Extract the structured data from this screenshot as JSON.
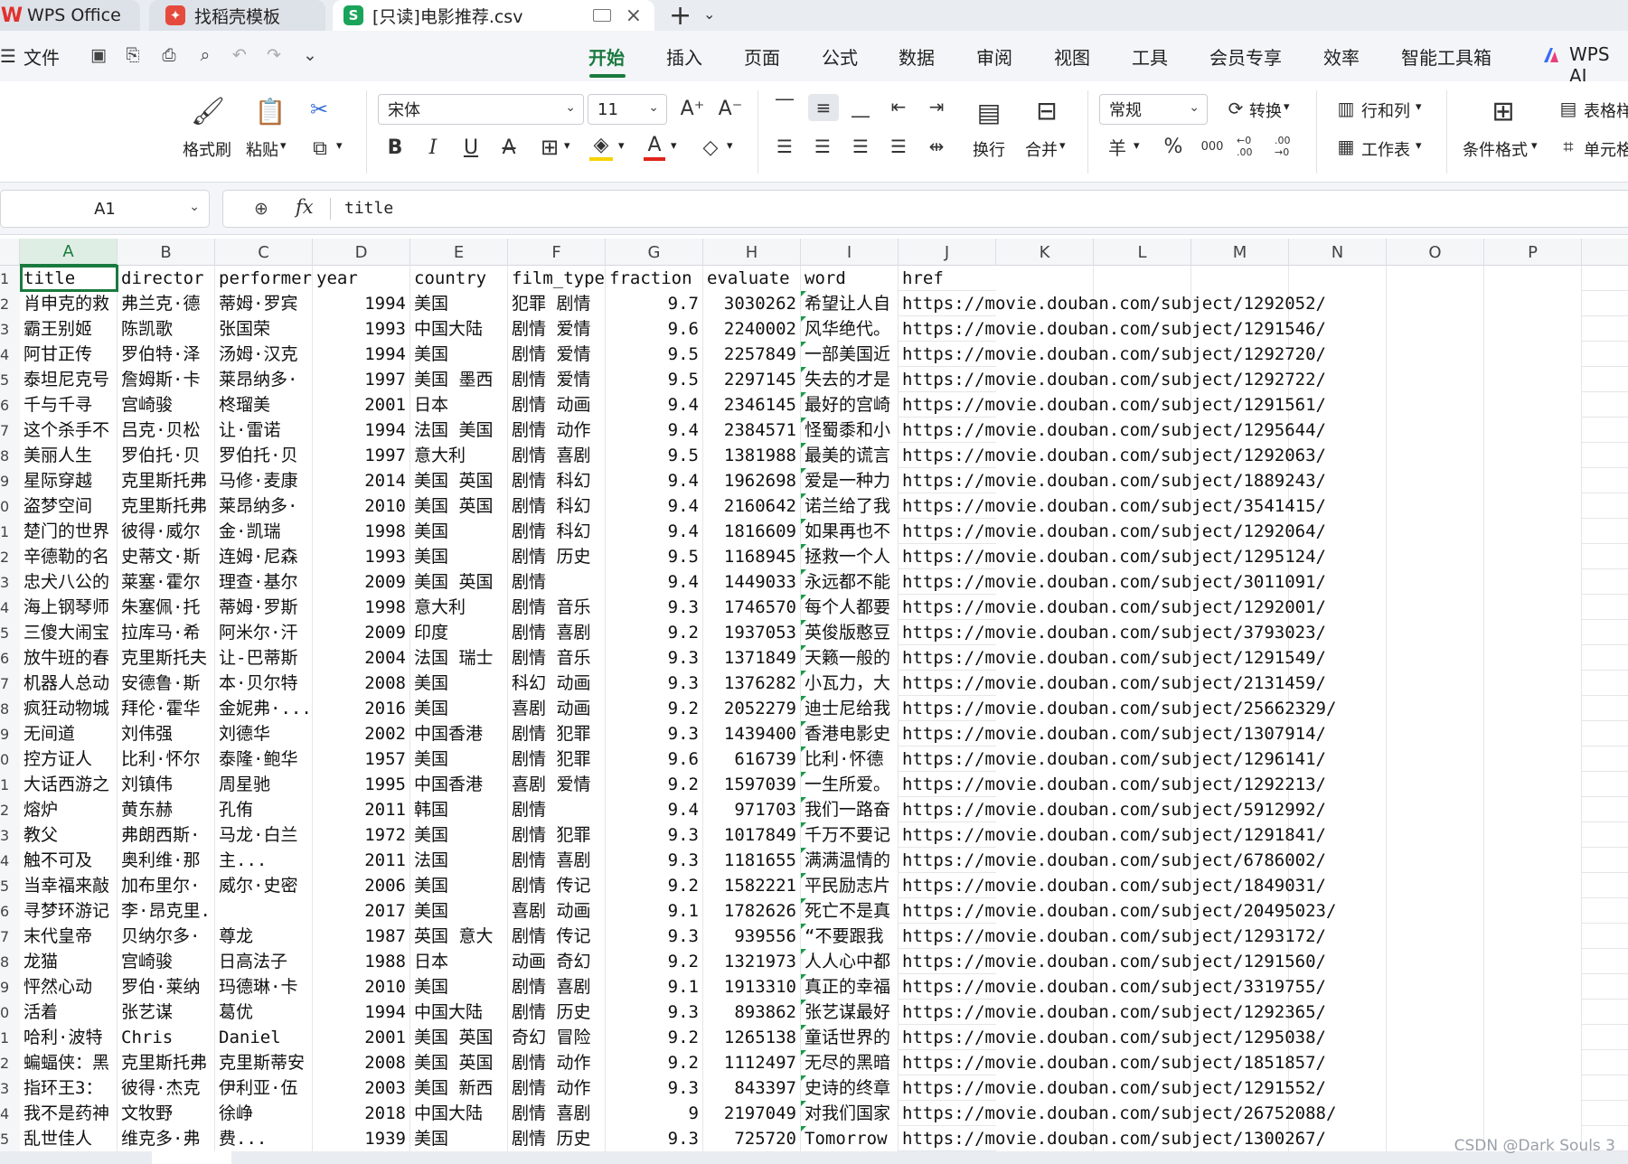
{
  "tabs": {
    "app": "WPS Office",
    "template": "找稻壳模板",
    "file": "[只读]电影推荐.csv",
    "file_icon_letter": "S"
  },
  "menu": {
    "file": "文件",
    "items": [
      "开始",
      "插入",
      "页面",
      "公式",
      "数据",
      "审阅",
      "视图",
      "工具",
      "会员专享",
      "效率",
      "智能工具箱",
      "WPS AI"
    ],
    "active_index": 0
  },
  "ribbon": {
    "format_painter": "格式刷",
    "paste": "粘贴",
    "font_name": "宋体",
    "font_size": "11",
    "wrap": "换行",
    "merge": "合并",
    "number_format": "常规",
    "convert": "转换",
    "rows_cols": "行和列",
    "worksheet": "工作表",
    "cond_format": "条件格式",
    "table_style": "表格样",
    "cell": "单元格",
    "bold": "B",
    "italic": "I",
    "underline": "U",
    "strike": "A",
    "currency": "羊",
    "percent": "%",
    "thousands": "000",
    "dec_inc": "←0 .00",
    "dec_dec": ".00 →0",
    "font_grow": "A⁺",
    "font_shrink": "A⁻"
  },
  "formula_bar": {
    "cell_ref": "A1",
    "fx": "fx",
    "value": "title"
  },
  "grid": {
    "columns": [
      "A",
      "B",
      "C",
      "D",
      "E",
      "F",
      "G",
      "H",
      "I",
      "J",
      "K",
      "L",
      "M",
      "N",
      "O",
      "P"
    ],
    "selected_column": "A",
    "row_numbers": [
      "1",
      "2",
      "3",
      "4",
      "5",
      "6",
      "7",
      "8",
      "9",
      "0",
      "1",
      "2",
      "3",
      "4",
      "5",
      "6",
      "7",
      "8",
      "9",
      "0",
      "1",
      "2",
      "3",
      "4",
      "5",
      "6",
      "7",
      "8",
      "9",
      "0",
      "1",
      "2",
      "3",
      "4",
      "5"
    ],
    "header": [
      "title",
      "director",
      "performer",
      "year",
      "country",
      "film_type",
      "fraction",
      "evaluate",
      "word",
      "href"
    ],
    "rows": [
      [
        "肖申克的救",
        "弗兰克·德",
        "蒂姆·罗宾",
        "1994",
        "美国",
        "犯罪 剧情",
        "9.7",
        "3030262",
        "希望让人自",
        "https://movie.douban.com/subject/1292052/"
      ],
      [
        "霸王别姬",
        "陈凯歌",
        "张国荣",
        "1993",
        "中国大陆 ",
        "剧情 爱情",
        "9.6",
        "2240002",
        "风华绝代。",
        "https://movie.douban.com/subject/1291546/"
      ],
      [
        "阿甘正传",
        "罗伯特·泽",
        "汤姆·汉克",
        "1994",
        "美国",
        "剧情 爱情",
        "9.5",
        "2257849",
        "一部美国近",
        "https://movie.douban.com/subject/1292720/"
      ],
      [
        "泰坦尼克号",
        "詹姆斯·卡",
        "莱昂纳多·",
        "1997",
        "美国 墨西",
        "剧情 爱情",
        "9.5",
        "2297145",
        "失去的才是",
        "https://movie.douban.com/subject/1292722/"
      ],
      [
        "千与千寻",
        "宫崎骏",
        "柊瑠美",
        "2001",
        "日本",
        "剧情 动画",
        "9.4",
        "2346145",
        "最好的宫崎",
        "https://movie.douban.com/subject/1291561/"
      ],
      [
        "这个杀手不",
        "吕克·贝松",
        "让·雷诺",
        "1994",
        "法国 美国",
        "剧情 动作",
        "9.4",
        "2384571",
        "怪蜀黍和小",
        "https://movie.douban.com/subject/1295644/"
      ],
      [
        "美丽人生",
        "罗伯托·贝",
        "罗伯托·贝",
        "1997",
        "意大利",
        "剧情 喜剧",
        "9.5",
        "1381988",
        "最美的谎言",
        "https://movie.douban.com/subject/1292063/"
      ],
      [
        "星际穿越",
        "克里斯托弗",
        "马修·麦康",
        "2014",
        "美国 英国",
        "剧情 科幻",
        "9.4",
        "1962698",
        "爱是一种力",
        "https://movie.douban.com/subject/1889243/"
      ],
      [
        "盗梦空间",
        "克里斯托弗",
        "莱昂纳多·",
        "2010",
        "美国 英国",
        "剧情 科幻",
        "9.4",
        "2160642",
        "诺兰给了我",
        "https://movie.douban.com/subject/3541415/"
      ],
      [
        "楚门的世界",
        "彼得·威尔",
        "金·凯瑞",
        "1998",
        "美国",
        "剧情 科幻",
        "9.4",
        "1816609",
        "如果再也不",
        "https://movie.douban.com/subject/1292064/"
      ],
      [
        "辛德勒的名",
        "史蒂文·斯",
        "连姆·尼森",
        "1993",
        "美国",
        "剧情 历史",
        "9.5",
        "1168945",
        "拯救一个人",
        "https://movie.douban.com/subject/1295124/"
      ],
      [
        "忠犬八公的",
        "莱塞·霍尔",
        "理查·基尔",
        "2009",
        "美国 英国",
        "剧情",
        "9.4",
        "1449033",
        "永远都不能",
        "https://movie.douban.com/subject/3011091/"
      ],
      [
        "海上钢琴师",
        "朱塞佩·托",
        "蒂姆·罗斯",
        "1998",
        "意大利",
        "剧情 音乐",
        "9.3",
        "1746570",
        "每个人都要",
        "https://movie.douban.com/subject/1292001/"
      ],
      [
        "三傻大闹宝",
        "拉库马·希",
        "阿米尔·汗",
        "2009",
        "印度",
        "剧情 喜剧",
        "9.2",
        "1937053",
        "英俊版憨豆",
        "https://movie.douban.com/subject/3793023/"
      ],
      [
        "放牛班的春",
        "克里斯托夫",
        "让-巴蒂斯",
        "2004",
        "法国 瑞士",
        "剧情 音乐",
        "9.3",
        "1371849",
        "天籁一般的",
        "https://movie.douban.com/subject/1291549/"
      ],
      [
        "机器人总动",
        "安德鲁·斯",
        "本·贝尔特",
        "2008",
        "美国",
        "科幻 动画",
        "9.3",
        "1376282",
        "小瓦力，大",
        "https://movie.douban.com/subject/2131459/"
      ],
      [
        "疯狂动物城",
        "拜伦·霍华",
        "金妮弗·...",
        "2016",
        "美国",
        "喜剧 动画",
        "9.2",
        "2052279",
        "迪士尼给我",
        "https://movie.douban.com/subject/25662329/"
      ],
      [
        "无间道",
        "刘伟强",
        "刘德华",
        "2002",
        "中国香港",
        "剧情 犯罪",
        "9.3",
        "1439400",
        "香港电影史",
        "https://movie.douban.com/subject/1307914/"
      ],
      [
        "控方证人",
        "比利·怀尔",
        "泰隆·鲍华",
        "1957",
        "美国",
        "剧情 犯罪",
        "9.6",
        "616739",
        "比利·怀德",
        "https://movie.douban.com/subject/1296141/"
      ],
      [
        "大话西游之",
        "刘镇伟",
        "周星驰",
        "1995",
        "中国香港 ",
        "喜剧 爱情",
        "9.2",
        "1597039",
        "一生所爱。",
        "https://movie.douban.com/subject/1292213/"
      ],
      [
        "熔炉",
        "黄东赫",
        "孔侑",
        "2011",
        "韩国",
        "剧情",
        "9.4",
        "971703",
        "我们一路奋",
        "https://movie.douban.com/subject/5912992/"
      ],
      [
        "教父",
        "弗朗西斯·",
        "马龙·白兰",
        "1972",
        "美国",
        "剧情 犯罪",
        "9.3",
        "1017849",
        "千万不要记",
        "https://movie.douban.com/subject/1291841/"
      ],
      [
        "触不可及",
        "奥利维·那",
        "主...",
        "2011",
        "法国",
        "剧情 喜剧",
        "9.3",
        "1181655",
        "满满温情的",
        "https://movie.douban.com/subject/6786002/"
      ],
      [
        "当幸福来敲",
        "加布里尔·",
        "威尔·史密",
        "2006",
        "美国",
        "剧情 传记",
        "9.2",
        "1582221",
        "平民励志片",
        "https://movie.douban.com/subject/1849031/"
      ],
      [
        "寻梦环游记",
        "李·昂克里...",
        "",
        "2017",
        "美国",
        "喜剧 动画",
        "9.1",
        "1782626",
        "死亡不是真",
        "https://movie.douban.com/subject/20495023/"
      ],
      [
        "末代皇帝",
        "贝纳尔多·",
        "尊龙",
        "1987",
        "英国 意大",
        "剧情 传记",
        "9.3",
        "939556",
        "“不要跟我",
        "https://movie.douban.com/subject/1293172/"
      ],
      [
        "龙猫",
        "宫崎骏",
        "日高法子",
        "1988",
        "日本",
        "动画 奇幻",
        "9.2",
        "1321973",
        "人人心中都",
        "https://movie.douban.com/subject/1291560/"
      ],
      [
        "怦然心动",
        "罗伯·莱纳",
        "玛德琳·卡",
        "2010",
        "美国",
        "剧情 喜剧",
        "9.1",
        "1913310",
        "真正的幸福",
        "https://movie.douban.com/subject/3319755/"
      ],
      [
        "活着",
        "张艺谋",
        "葛优",
        "1994",
        "中国大陆 ",
        "剧情 历史",
        "9.3",
        "893862",
        "张艺谋最好",
        "https://movie.douban.com/subject/1292365/"
      ],
      [
        "哈利·波特",
        "Chris",
        "Daniel",
        "2001",
        "美国 英国",
        "奇幻 冒险",
        "9.2",
        "1265138",
        "童话世界的",
        "https://movie.douban.com/subject/1295038/"
      ],
      [
        "蝙蝠侠：黑",
        "克里斯托弗",
        "克里斯蒂安",
        "2008",
        "美国 英国",
        "剧情 动作",
        "9.2",
        "1112497",
        "无尽的黑暗",
        "https://movie.douban.com/subject/1851857/"
      ],
      [
        "指环王3：",
        "彼得·杰克",
        "伊利亚·伍",
        "2003",
        "美国 新西",
        "剧情 动作",
        "9.3",
        "843397",
        "史诗的终章",
        "https://movie.douban.com/subject/1291552/"
      ],
      [
        "我不是药神",
        "文牧野",
        "徐峥",
        "2018",
        "中国大陆",
        "剧情 喜剧",
        "9",
        "2197049",
        "对我们国家",
        "https://movie.douban.com/subject/26752088/"
      ],
      [
        "乱世佳人",
        "维克多·弗",
        "费...",
        "1939",
        "美国",
        "剧情 历史",
        "9.3",
        "725720",
        "Tomorrow ",
        "https://movie.douban.com/subject/1300267/"
      ]
    ]
  },
  "watermark": "CSDN @Dark Souls 3"
}
